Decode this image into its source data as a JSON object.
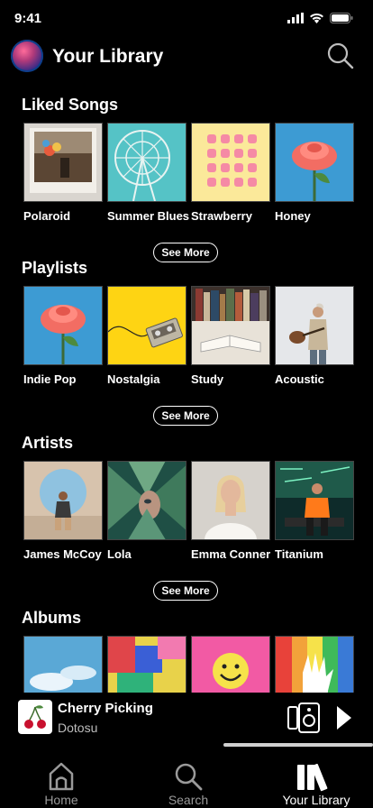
{
  "status_bar": {
    "time": "9:41"
  },
  "header": {
    "title": "Your Library"
  },
  "sections": [
    {
      "title": "Liked Songs",
      "items": [
        "Polaroid",
        "Summer Blues",
        "Strawberry",
        "Honey"
      ],
      "see_more": "See More"
    },
    {
      "title": "Playlists",
      "items": [
        "Indie Pop",
        "Nostalgia",
        "Study",
        "Acoustic"
      ],
      "see_more": "See More"
    },
    {
      "title": "Artists",
      "items": [
        "James McCoy",
        "Lola",
        "Emma Conner",
        "Titanium"
      ],
      "see_more": "See More"
    },
    {
      "title": "Albums",
      "items": [
        "",
        "",
        "",
        ""
      ]
    }
  ],
  "player": {
    "title": "Cherry Picking",
    "artist": "Dotosu"
  },
  "tabs": [
    {
      "label": "Home",
      "icon": "home-icon"
    },
    {
      "label": "Search",
      "icon": "search-icon"
    },
    {
      "label": "Your Library",
      "icon": "library-icon",
      "active": true
    }
  ],
  "colors": {
    "background": "#000000",
    "text": "#ffffff",
    "muted": "#9a9a9a"
  }
}
